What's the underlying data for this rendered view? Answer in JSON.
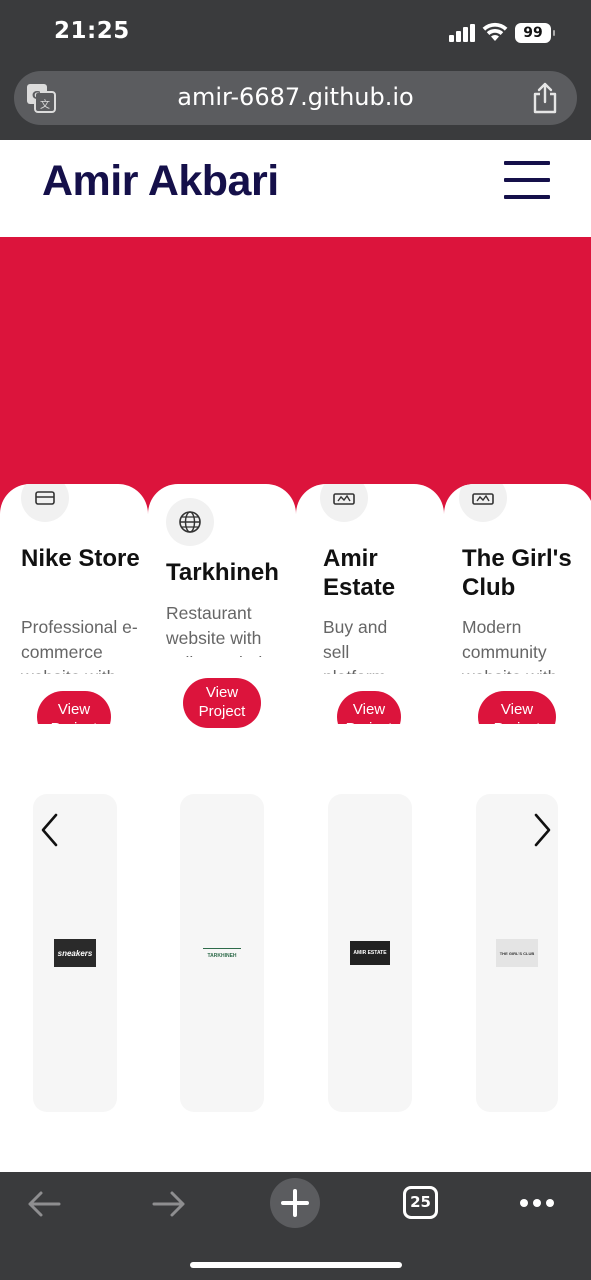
{
  "status_bar": {
    "time": "21:25",
    "battery": "99"
  },
  "browser": {
    "url": "amir-6687.github.io",
    "tab_count": "25"
  },
  "site": {
    "brand": "Amir Akbari",
    "accent_color": "#dc143c",
    "brand_color": "#15104a"
  },
  "projects": [
    {
      "title": "Nike Store",
      "description": "Professional e-commerce website with",
      "button": "View Project",
      "icon": "cart-icon",
      "thumbnail_text": "sneakers"
    },
    {
      "title": "Tarkhineh",
      "description": "Restaurant website with online ordering",
      "button": "View Project",
      "icon": "globe-icon",
      "thumbnail_text": "TARKHINEH"
    },
    {
      "title": "Amir Estate",
      "description": "Buy and sell platform",
      "button": "View Project",
      "icon": "realestate-icon",
      "thumbnail_text": "AMIR ESTATE"
    },
    {
      "title": "The Girl's Club",
      "description": "Modern community website with",
      "button": "View Project",
      "icon": "realestate-icon",
      "thumbnail_text": "THE GIRL'S CLUB"
    }
  ]
}
